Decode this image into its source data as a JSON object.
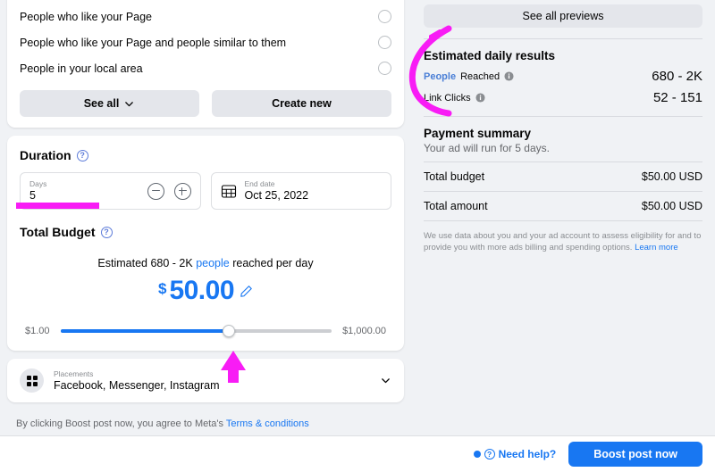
{
  "audience": {
    "options": [
      {
        "label": "People who like your Page",
        "selected": false
      },
      {
        "label": "People who like your Page and people similar to them",
        "selected": false
      },
      {
        "label": "People in your local area",
        "selected": false
      }
    ],
    "see_all_label": "See all",
    "create_new_label": "Create new"
  },
  "duration": {
    "title": "Duration",
    "help_icon": "question-circle-icon",
    "days_caption": "Days",
    "days_value": "5",
    "decrement_icon": "minus-circle-icon",
    "increment_icon": "plus-circle-icon",
    "calendar_icon": "calendar-icon",
    "end_date_caption": "End date",
    "end_date_value": "Oct 25, 2022"
  },
  "budget": {
    "title": "Total Budget",
    "help_icon": "question-circle-icon",
    "estimate_prefix": "Estimated 680 - 2K",
    "estimate_link": "people",
    "estimate_suffix": "reached per day",
    "currency_symbol": "$",
    "amount": "50.00",
    "edit_icon": "pencil-icon",
    "slider_min_label": "$1.00",
    "slider_max_label": "$1,000.00",
    "slider_fill_percent": 62
  },
  "placements": {
    "icon": "grid-icon",
    "caption": "Placements",
    "value": "Facebook, Messenger, Instagram",
    "chevron_icon": "chevron-down-icon"
  },
  "terms": {
    "text": "By clicking Boost post now, you agree to Meta's",
    "link": "Terms & conditions"
  },
  "right_panel": {
    "preview_button": "See all previews",
    "results_title": "Estimated daily results",
    "results": [
      {
        "link_word": "People",
        "label": "Reached",
        "info_icon": "info-icon",
        "value": "680 - 2K"
      },
      {
        "link_word": "",
        "label": "Link Clicks",
        "info_icon": "info-icon",
        "value": "52 - 151"
      }
    ],
    "payment_title": "Payment summary",
    "payment_subtitle": "Your ad will run for 5 days.",
    "payment_rows": [
      {
        "label": "Total budget",
        "value": "$50.00 USD"
      },
      {
        "label": "Total amount",
        "value": "$50.00 USD"
      }
    ],
    "disclaimer": "We use data about you and your ad account to assess eligibility for and to provide you with more ads billing and spending options.",
    "disclaimer_link": "Learn more"
  },
  "footer": {
    "notification_dot": "blue-dot",
    "help_icon": "question-circle-icon",
    "help_label": "Need help?",
    "primary_button": "Boost post now"
  },
  "annotations": {
    "color": "#f81cf5",
    "days_underline": "highlight-bar-under-days-field",
    "budget_arrow": "up-arrow-pointing-at-slider-knob",
    "results_arc": "c-shaped-arc-around-estimated-daily-results"
  },
  "colors": {
    "accent_blue": "#1877f2",
    "page_bg": "#f0f2f5",
    "card_bg": "#ffffff",
    "annotation_magenta": "#f81cf5"
  }
}
